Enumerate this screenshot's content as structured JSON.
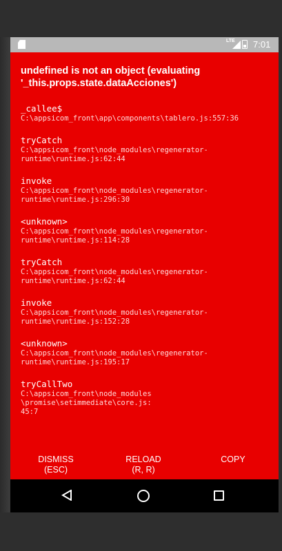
{
  "status_bar": {
    "network_label": "LTE",
    "time": "7:01"
  },
  "error": {
    "title": "undefined is not an object (evaluating '_this.props.state.dataAcciones')",
    "stack": [
      {
        "fn": "_callee$",
        "path": "C:\\appsicom_front\\app\\components\\tablero.js:557:36"
      },
      {
        "fn": "tryCatch",
        "path": "C:\\appsicom_front\\node_modules\\regenerator-\nruntime\\runtime.js:62:44"
      },
      {
        "fn": "invoke",
        "path": "C:\\appsicom_front\\node_modules\\regenerator-\nruntime\\runtime.js:296:30"
      },
      {
        "fn": "<unknown>",
        "path": "C:\\appsicom_front\\node_modules\\regenerator-\nruntime\\runtime.js:114:28"
      },
      {
        "fn": "tryCatch",
        "path": "C:\\appsicom_front\\node_modules\\regenerator-\nruntime\\runtime.js:62:44"
      },
      {
        "fn": "invoke",
        "path": "C:\\appsicom_front\\node_modules\\regenerator-\nruntime\\runtime.js:152:28"
      },
      {
        "fn": "<unknown>",
        "path": "C:\\appsicom_front\\node_modules\\regenerator-\nruntime\\runtime.js:195:17"
      },
      {
        "fn": "tryCallTwo",
        "path": "C:\\appsicom_front\\node_modules\n\\promise\\setimmediate\\core.js:\n45:7"
      }
    ]
  },
  "actions": {
    "dismiss": "DISMISS\n(ESC)",
    "reload": "RELOAD\n(R, R)",
    "copy": "COPY"
  },
  "icons": {
    "status_left": "sd-card-icon",
    "network": "lte-signal-icon",
    "battery": "battery-icon",
    "nav_back": "back-triangle-icon",
    "nav_home": "home-circle-icon",
    "nav_recent": "recent-apps-square-icon"
  },
  "colors": {
    "error_background": "#e80000",
    "status_bar": "#b8b8b8",
    "nav_bar": "#000000",
    "text": "#ffffff"
  }
}
